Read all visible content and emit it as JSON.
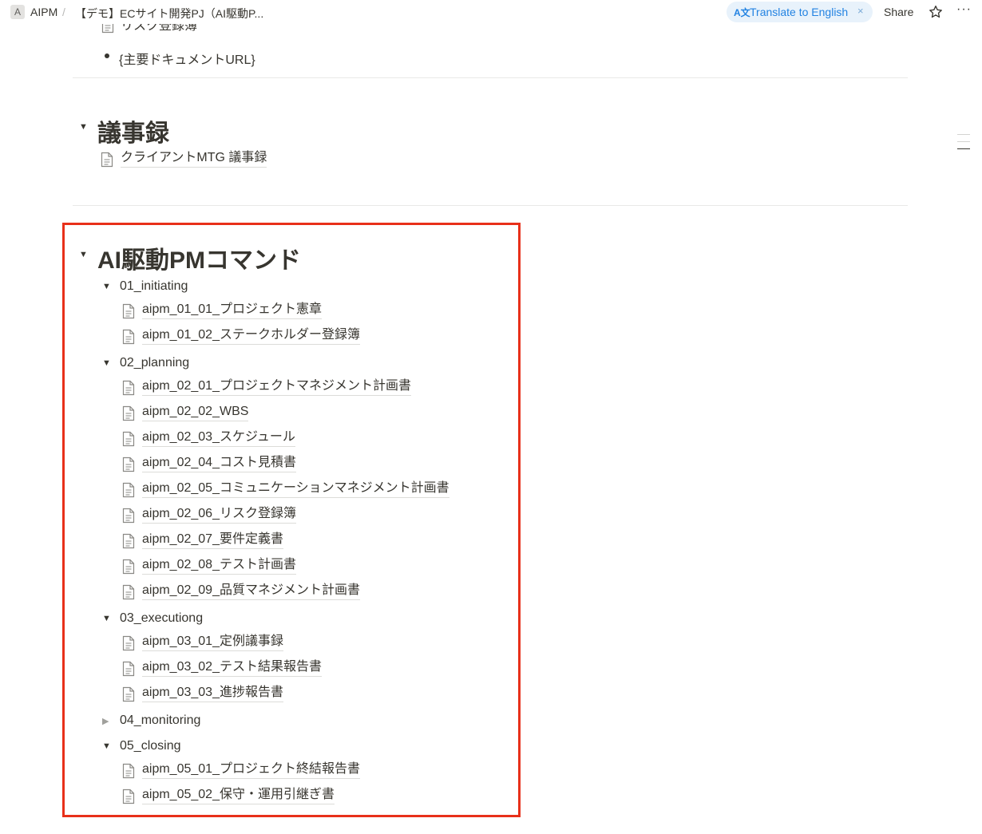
{
  "topbar": {
    "workspace_initial": "A",
    "breadcrumb_workspace": "AIPM",
    "breadcrumb_separator": "/",
    "breadcrumb_page": "【デモ】ECサイト開発PJ（AI駆動P...",
    "translate_label": "Translate to English",
    "translate_icon": "translate-icon",
    "translate_close": "×",
    "share_label": "Share",
    "more_label": "···"
  },
  "docs_section": {
    "partial_item": "リスク登録簿",
    "bullet_text": "{主要ドキュメントURL}"
  },
  "minutes_section": {
    "heading": "議事録",
    "items": [
      "クライアントMTG 議事録"
    ]
  },
  "commands_section": {
    "heading": "AI駆動PMコマンド",
    "groups": [
      {
        "label": "01_initiating",
        "expanded": true,
        "items": [
          "aipm_01_01_プロジェクト憲章",
          "aipm_01_02_ステークホルダー登録簿"
        ]
      },
      {
        "label": "02_planning",
        "expanded": true,
        "items": [
          "aipm_02_01_プロジェクトマネジメント計画書",
          "aipm_02_02_WBS",
          "aipm_02_03_スケジュール",
          "aipm_02_04_コスト見積書",
          "aipm_02_05_コミュニケーションマネジメント計画書",
          "aipm_02_06_リスク登録簿",
          "aipm_02_07_要件定義書",
          "aipm_02_08_テスト計画書",
          "aipm_02_09_品質マネジメント計画書"
        ]
      },
      {
        "label": "03_executiong",
        "expanded": true,
        "items": [
          "aipm_03_01_定例議事録",
          "aipm_03_02_テスト結果報告書",
          "aipm_03_03_進捗報告書"
        ]
      },
      {
        "label": "04_monitoring",
        "expanded": false,
        "items": []
      },
      {
        "label": "05_closing",
        "expanded": true,
        "items": [
          "aipm_05_01_プロジェクト終結報告書",
          "aipm_05_02_保守・運用引継ぎ書"
        ]
      }
    ]
  },
  "colors": {
    "highlight_border": "#e8301a",
    "accent": "#2383e2",
    "text": "#37352f"
  }
}
